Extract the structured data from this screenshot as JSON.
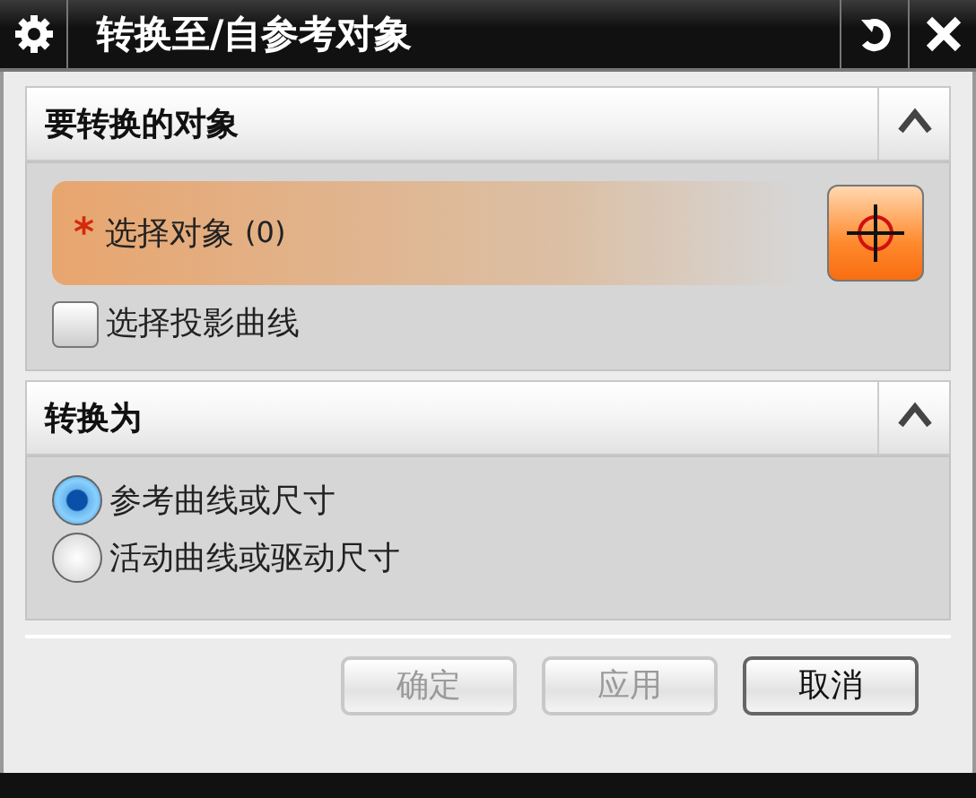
{
  "window": {
    "title": "转换至/自参考对象"
  },
  "sections": [
    {
      "title": "要转换的对象",
      "expanded": true,
      "select": {
        "required_mark": "*",
        "label": "选择对象",
        "count": "(0)"
      },
      "checkbox": {
        "label": "选择投影曲线",
        "checked": false
      }
    },
    {
      "title": "转换为",
      "expanded": true,
      "radios": [
        {
          "label": "参考曲线或尺寸",
          "selected": true
        },
        {
          "label": "活动曲线或驱动尺寸",
          "selected": false
        }
      ]
    }
  ],
  "buttons": [
    {
      "label": "确定",
      "disabled": true
    },
    {
      "label": "应用",
      "disabled": true
    },
    {
      "label": "取消",
      "disabled": false
    }
  ]
}
